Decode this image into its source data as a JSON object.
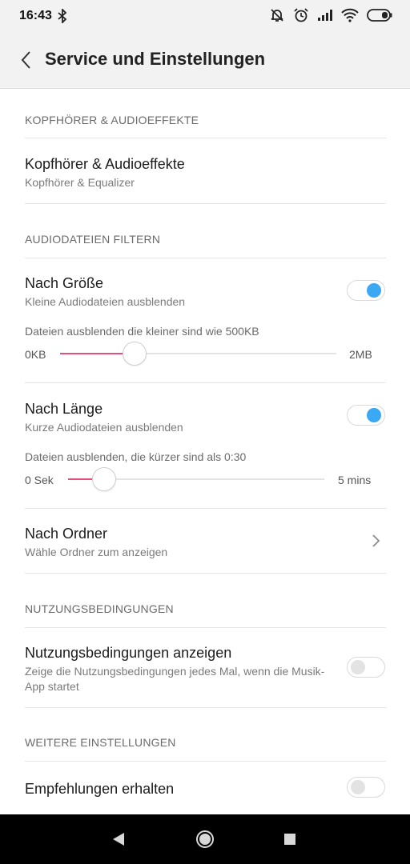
{
  "status_bar": {
    "time": "16:43",
    "icons": [
      "bluetooth-icon",
      "notifications-off-icon",
      "alarm-icon",
      "signal-icon",
      "wifi-icon",
      "battery-icon"
    ]
  },
  "app_bar": {
    "title": "Service und Einstellungen"
  },
  "sections": {
    "headphones": {
      "header": "KOPFHÖRER & AUDIOEFFEKTE",
      "item_title": "Kopfhörer & Audioeffekte",
      "item_sub": "Kopfhörer & Equalizer"
    },
    "filter": {
      "header": "AUDIODATEIEN FILTERN",
      "by_size": {
        "title": "Nach Größe",
        "sub": "Kleine Audiodateien ausblenden",
        "enabled": true,
        "caption": "Dateien ausblenden die kleiner sind wie 500KB",
        "min_label": "0KB",
        "max_label": "2MB",
        "value_fraction": 0.27
      },
      "by_length": {
        "title": "Nach Länge",
        "sub": "Kurze Audiodateien ausblenden",
        "enabled": true,
        "caption": "Dateien ausblenden, die kürzer sind als 0:30",
        "min_label": "0 Sek",
        "max_label": "5 mins",
        "value_fraction": 0.14
      },
      "by_folder": {
        "title": "Nach Ordner",
        "sub": "Wähle Ordner zum anzeigen"
      }
    },
    "terms": {
      "header": "NUTZUNGSBEDINGUNGEN",
      "item_title": "Nutzungsbedingungen anzeigen",
      "item_sub": "Zeige die Nutzungsbedingungen jedes Mal, wenn die Musik-App startet",
      "enabled": false
    },
    "more": {
      "header": "WEITERE EINSTELLUNGEN",
      "item_title": "Empfehlungen erhalten",
      "enabled": false
    }
  },
  "colors": {
    "accent_toggle": "#3aa8f2",
    "slider_fill": "#e0507a"
  }
}
